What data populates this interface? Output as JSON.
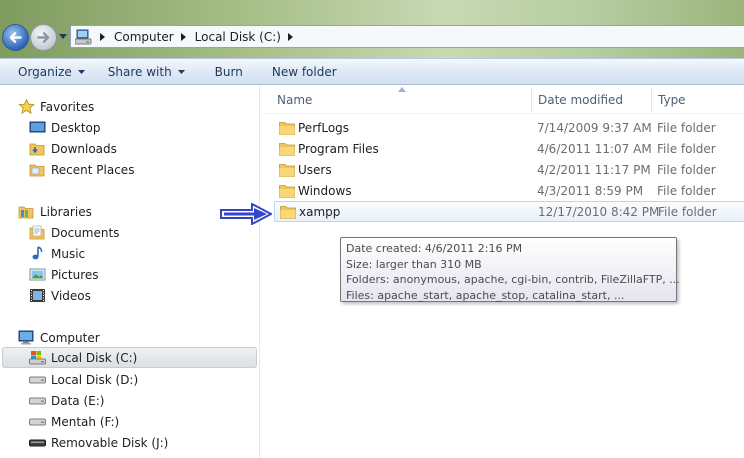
{
  "address": {
    "crumbs": [
      "Computer",
      "Local Disk (C:)"
    ]
  },
  "toolbar": {
    "organize": "Organize",
    "share_with": "Share with",
    "burn": "Burn",
    "new_folder": "New folder"
  },
  "nav": {
    "favorites": {
      "header": "Favorites",
      "items": [
        "Desktop",
        "Downloads",
        "Recent Places"
      ]
    },
    "libraries": {
      "header": "Libraries",
      "items": [
        "Documents",
        "Music",
        "Pictures",
        "Videos"
      ]
    },
    "computer": {
      "header": "Computer",
      "items": [
        "Local Disk (C:)",
        "Local Disk (D:)",
        "Data (E:)",
        "Mentah (F:)",
        "Removable Disk (J:)"
      ],
      "selected": "Local Disk (C:)"
    }
  },
  "columns": {
    "name": "Name",
    "date_modified": "Date modified",
    "type": "Type"
  },
  "files": [
    {
      "name": "PerfLogs",
      "date": "7/14/2009 9:37 AM",
      "type": "File folder"
    },
    {
      "name": "Program Files",
      "date": "4/6/2011 11:07 AM",
      "type": "File folder"
    },
    {
      "name": "Users",
      "date": "4/2/2011 11:17 PM",
      "type": "File folder"
    },
    {
      "name": "Windows",
      "date": "4/3/2011 8:59 PM",
      "type": "File folder"
    },
    {
      "name": "xampp",
      "date": "12/17/2010 8:42 PM",
      "type": "File folder"
    }
  ],
  "tooltip": {
    "lines": [
      "Date created: 4/6/2011 2:16 PM",
      "Size: larger than 310 MB",
      "Folders: anonymous, apache, cgi-bin, contrib, FileZillaFTP, ...",
      "Files: apache_start, apache_stop, catalina_start, ..."
    ]
  },
  "icons": {
    "folder": "folder-icon",
    "back": "back-arrow-icon",
    "forward": "forward-arrow-icon",
    "indicator": "blue-arrow-indicator"
  },
  "colors": {
    "toolbar_text": "#1e395b",
    "indicator_arrow": "#3446c8",
    "folder_yellow": "#f2c45a"
  }
}
